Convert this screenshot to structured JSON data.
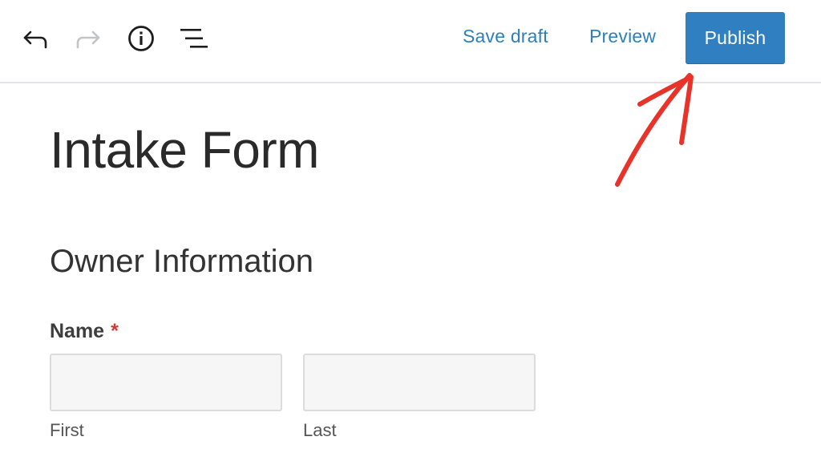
{
  "toolbar": {
    "icons": {
      "undo": "undo-arrow-icon",
      "redo": "redo-arrow-icon",
      "info": "info-circle-icon",
      "outline": "list-outline-icon"
    },
    "save_draft_label": "Save draft",
    "preview_label": "Preview",
    "publish_label": "Publish"
  },
  "annotation": {
    "arrow_icon": "red-arrow-annotation",
    "color": "#e8332a"
  },
  "page": {
    "title": "Intake Form",
    "section_title": "Owner Information",
    "name_field": {
      "label": "Name",
      "required_marker": "*",
      "first": {
        "value": "",
        "sublabel": "First"
      },
      "last": {
        "value": "",
        "sublabel": "Last"
      }
    }
  },
  "colors": {
    "accent": "#2f7fc1",
    "link": "#2f7fbc",
    "required": "#d63638"
  }
}
